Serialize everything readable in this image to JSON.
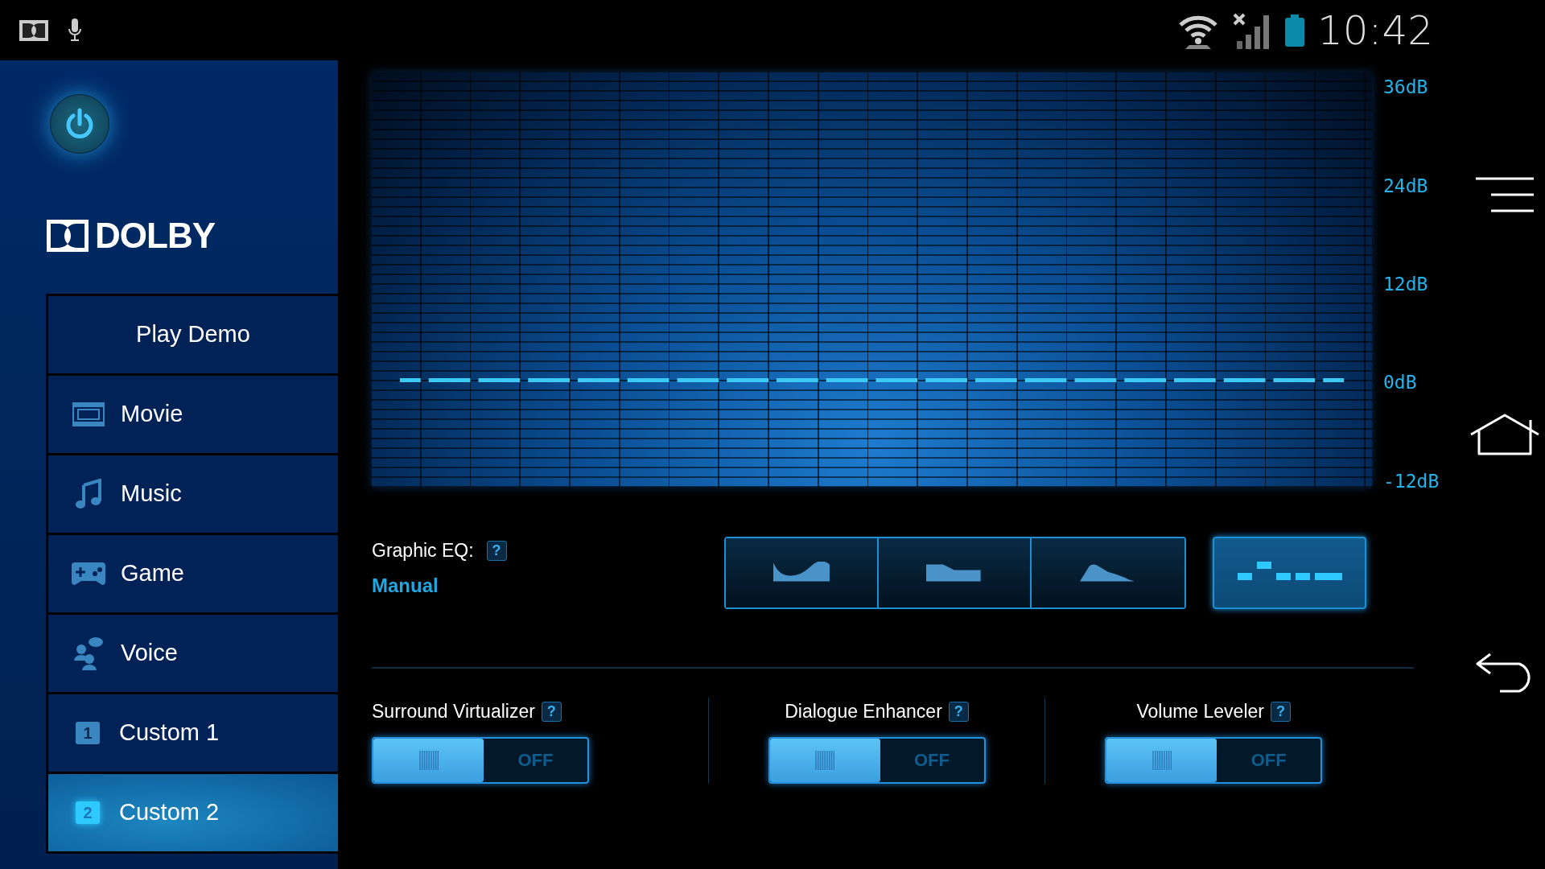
{
  "status_bar": {
    "time": "10:42"
  },
  "power": {
    "on": true
  },
  "logo": {
    "text": "DOLBY"
  },
  "sidebar": {
    "items": [
      {
        "label": "Play Demo",
        "kind": "plain",
        "selected": false
      },
      {
        "label": "Movie",
        "kind": "film",
        "selected": false
      },
      {
        "label": "Music",
        "kind": "note",
        "selected": false
      },
      {
        "label": "Game",
        "kind": "gamepad",
        "selected": false
      },
      {
        "label": "Voice",
        "kind": "people",
        "selected": false
      },
      {
        "label": "Custom 1",
        "kind": "number",
        "badge": "1",
        "selected": false
      },
      {
        "label": "Custom 2",
        "kind": "number",
        "badge": "2",
        "selected": true
      }
    ]
  },
  "eq": {
    "chart_data": {
      "type": "line",
      "categories": [
        null,
        null,
        null,
        null,
        null,
        null,
        null,
        null,
        null,
        null,
        null,
        null,
        null,
        null,
        null,
        null,
        null,
        null,
        null,
        null
      ],
      "series": [
        {
          "color": "#3ccaf5",
          "line_style": "dashed",
          "values": [
            0,
            0,
            0,
            0,
            0,
            0,
            0,
            0,
            0,
            0,
            0,
            0,
            0,
            0,
            0,
            0,
            0,
            0,
            0,
            0
          ]
        }
      ],
      "ylim": [
        -13,
        37.5
      ],
      "yticks": [
        {
          "value": 36,
          "label": "36dB"
        },
        {
          "value": 24,
          "label": "24dB"
        },
        {
          "value": 12,
          "label": "12dB"
        },
        {
          "value": 0,
          "label": "0dB"
        },
        {
          "value": -12,
          "label": "-12dB"
        }
      ]
    }
  },
  "graphic_eq": {
    "label": "Graphic EQ:",
    "help": "?",
    "mode": "Manual",
    "presets": [
      {
        "kind": "dip",
        "selected": false
      },
      {
        "kind": "shelf",
        "selected": false
      },
      {
        "kind": "peak",
        "selected": false
      }
    ],
    "manual": {
      "selected": true
    }
  },
  "toggles": [
    {
      "label": "Surround Virtualizer",
      "help": "?",
      "on": false,
      "state_text": "OFF"
    },
    {
      "label": "Dialogue Enhancer",
      "help": "?",
      "on": false,
      "state_text": "OFF"
    },
    {
      "label": "Volume Leveler",
      "help": "?",
      "on": false,
      "state_text": "OFF"
    }
  ]
}
